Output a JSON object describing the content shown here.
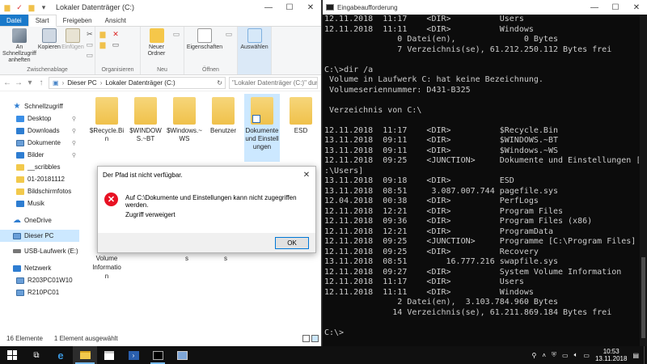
{
  "explorer": {
    "title": "Lokaler Datenträger (C:)",
    "tabs": [
      "Datei",
      "Start",
      "Freigeben",
      "Ansicht"
    ],
    "ribbon": {
      "groups": [
        {
          "label": "Zwischenablage",
          "buttons": [
            "An Schnellzugriff anheften",
            "Kopieren",
            "Einfügen"
          ]
        },
        {
          "label": "Organisieren",
          "buttons": []
        },
        {
          "label": "Neu",
          "buttons": [
            "Neuer Ordner"
          ]
        },
        {
          "label": "Öffnen",
          "buttons": [
            "Eigenschaften"
          ]
        },
        {
          "label": "",
          "buttons": [
            "Auswählen"
          ]
        }
      ]
    },
    "address": {
      "crumbs": [
        "Dieser PC",
        "Lokaler Datenträger (C:)"
      ],
      "search_placeholder": "\"Lokaler Datenträger (C:)\" durc..."
    },
    "nav": [
      {
        "label": "Schnellzugriff",
        "icon": "star-icon",
        "level": 0,
        "pinned": false
      },
      {
        "label": "Desktop",
        "icon": "desktop-icon",
        "level": 1,
        "pinned": true
      },
      {
        "label": "Downloads",
        "icon": "download-icon",
        "level": 1,
        "pinned": true
      },
      {
        "label": "Dokumente",
        "icon": "documents-icon",
        "level": 1,
        "pinned": true
      },
      {
        "label": "Bilder",
        "icon": "pictures-icon",
        "level": 1,
        "pinned": true
      },
      {
        "label": "__scribbles",
        "icon": "folder-icon",
        "level": 1,
        "pinned": false
      },
      {
        "label": "01-20181112",
        "icon": "folder-icon",
        "level": 1,
        "pinned": false
      },
      {
        "label": "Bildschirmfotos",
        "icon": "folder-icon",
        "level": 1,
        "pinned": false
      },
      {
        "label": "Musik",
        "icon": "music-icon",
        "level": 1,
        "pinned": false
      },
      {
        "label": "OneDrive",
        "icon": "cloud-icon",
        "level": 0,
        "pinned": false
      },
      {
        "label": "Dieser PC",
        "icon": "pc-icon",
        "level": 0,
        "pinned": false,
        "selected": true
      },
      {
        "label": "USB-Laufwerk (E:)",
        "icon": "usb-drive-icon",
        "level": 0,
        "pinned": false
      },
      {
        "label": "Netzwerk",
        "icon": "network-icon",
        "level": 0,
        "pinned": false
      },
      {
        "label": "R203PC01W10",
        "icon": "computer-icon",
        "level": 1,
        "pinned": false
      },
      {
        "label": "R210PC01",
        "icon": "computer-icon",
        "level": 1,
        "pinned": false
      }
    ],
    "files": [
      {
        "label": "$Recycle.Bin"
      },
      {
        "label": "$WINDOWS.~BT"
      },
      {
        "label": "$Windows.~WS"
      },
      {
        "label": "Benutzer"
      },
      {
        "label": "Dokumente und Einstellungen",
        "selected": true,
        "link": true
      },
      {
        "label": "ESD"
      }
    ],
    "partial_items": [
      "Volume Informatio n",
      "s",
      "s"
    ],
    "status": {
      "count": "16 Elemente",
      "selected": "1 Element ausgewählt"
    }
  },
  "dialog": {
    "title": "Der Pfad ist nicht verfügbar.",
    "message": "Auf C:\\Dokumente und Einstellungen kann nicht zugegriffen werden.",
    "detail": "Zugriff verweigert",
    "ok_label": "OK"
  },
  "console": {
    "title": "Eingabeaufforderung",
    "lines": [
      "12.11.2018  11:17    <DIR>          Users",
      "12.11.2018  11:11    <DIR>          Windows",
      "               0 Datei(en),              0 Bytes",
      "               7 Verzeichnis(se), 61.212.250.112 Bytes frei",
      "",
      "C:\\>dir /a",
      " Volume in Laufwerk C: hat keine Bezeichnung.",
      " Volumeseriennummer: D431-B325",
      "",
      " Verzeichnis von C:\\",
      "",
      "12.11.2018  11:17    <DIR>          $Recycle.Bin",
      "13.11.2018  09:11    <DIR>          $WINDOWS.~BT",
      "13.11.2018  09:11    <DIR>          $Windows.~WS",
      "12.11.2018  09:25    <JUNCTION>     Dokumente und Einstellungen [C",
      ":\\Users]",
      "13.11.2018  09:18    <DIR>          ESD",
      "13.11.2018  08:51     3.087.007.744 pagefile.sys",
      "12.04.2018  00:38    <DIR>          PerfLogs",
      "12.11.2018  12:21    <DIR>          Program Files",
      "12.11.2018  09:36    <DIR>          Program Files (x86)",
      "12.11.2018  12:21    <DIR>          ProgramData",
      "12.11.2018  09:25    <JUNCTION>     Programme [C:\\Program Files]",
      "12.11.2018  09:25    <DIR>          Recovery",
      "13.11.2018  08:51        16.777.216 swapfile.sys",
      "12.11.2018  09:27    <DIR>          System Volume Information",
      "12.11.2018  11:17    <DIR>          Users",
      "12.11.2018  11:11    <DIR>          Windows",
      "               2 Datei(en),  3.103.784.960 Bytes",
      "              14 Verzeichnis(se), 61.211.869.184 Bytes frei",
      "",
      "C:\\>"
    ]
  },
  "taskbar": {
    "apps": [
      {
        "name": "task-view-icon",
        "state": "none"
      },
      {
        "name": "edge-icon",
        "state": "none"
      },
      {
        "name": "file-explorer-icon",
        "state": "active"
      },
      {
        "name": "store-icon",
        "state": "none"
      },
      {
        "name": "powershell-icon",
        "state": "none"
      },
      {
        "name": "command-prompt-icon",
        "state": "running"
      },
      {
        "name": "remote-desktop-icon",
        "state": "none"
      }
    ],
    "time": "10:53",
    "date": "13.11.2018"
  },
  "colors": {
    "accent": "#1979ca",
    "selection": "#cce8ff",
    "console_bg": "#0c0c0c",
    "console_fg": "#cccccc",
    "error": "#e81123"
  }
}
